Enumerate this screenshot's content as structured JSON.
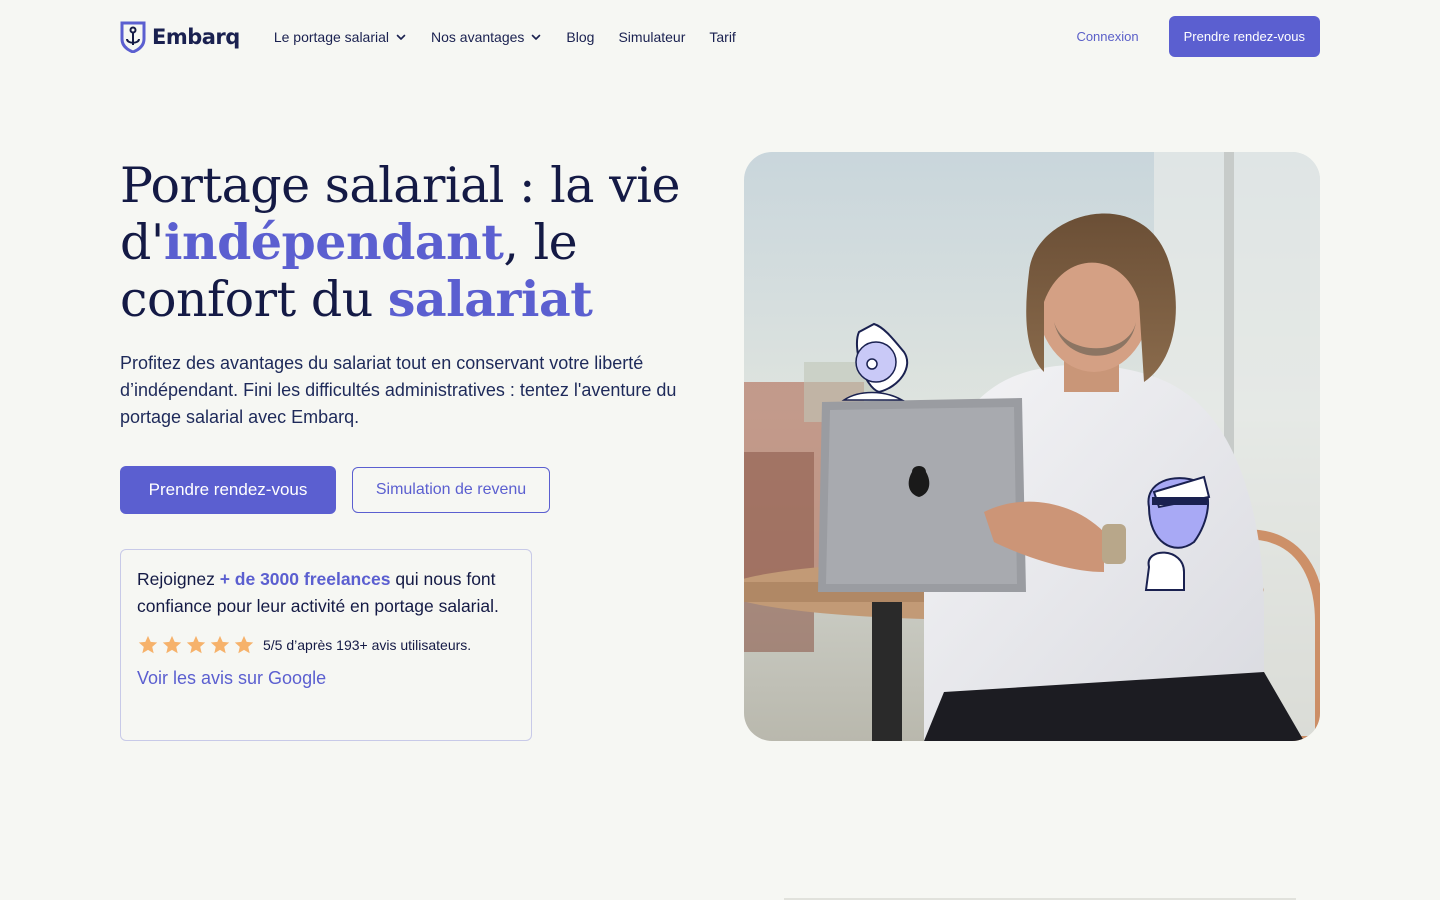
{
  "brand": {
    "name": "Embarq",
    "accent": "#5b5fd0",
    "navy": "#141a45"
  },
  "nav": {
    "items": [
      {
        "label": "Le portage salarial",
        "has_dropdown": true
      },
      {
        "label": "Nos avantages",
        "has_dropdown": true
      },
      {
        "label": "Blog",
        "has_dropdown": false
      },
      {
        "label": "Simulateur",
        "has_dropdown": false
      },
      {
        "label": "Tarif",
        "has_dropdown": false
      }
    ],
    "login_label": "Connexion",
    "cta_label": "Prendre rendez-vous"
  },
  "hero": {
    "title_part1": "Portage salarial : la vie d'",
    "title_highlight1": "indépendant",
    "title_part2": ", le confort du ",
    "title_highlight2": "salariat",
    "subtitle": "Profitez des avantages du salariat tout en conservant votre liberté d’indépendant. Fini les difficultés administratives : tentez l'aventure du portage salarial avec Embarq.",
    "primary_cta": "Prendre rendez-vous",
    "secondary_cta": "Simulation de revenu"
  },
  "trust_card": {
    "text_before": "Rejoignez ",
    "text_highlight": "+ de 3000 freelances",
    "text_after": " qui nous font confiance pour leur activité en portage salarial.",
    "stars": 5,
    "star_color": "#f6b26b",
    "rating_text": "5/5 d’après 193+ avis utilisateurs.",
    "link_label": "Voir les avis sur Google"
  },
  "icons": [
    "anchor-shield-logo-icon",
    "chevron-down-icon",
    "star-icon"
  ]
}
